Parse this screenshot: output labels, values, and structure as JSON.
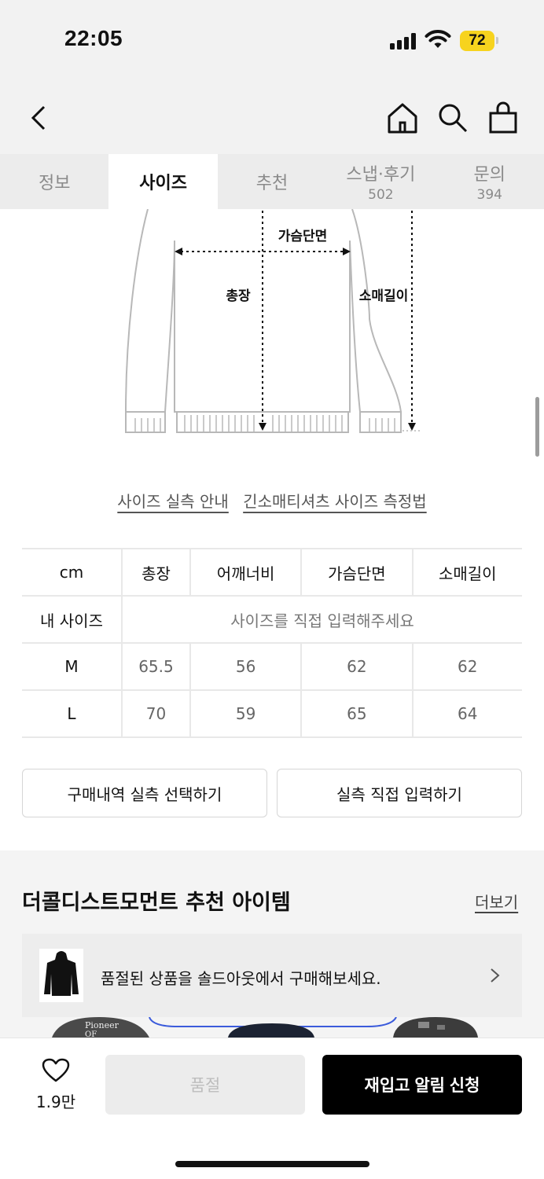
{
  "status_bar": {
    "time": "22:05",
    "battery": "72"
  },
  "header": {
    "back_icon": "chevron-left-icon",
    "icons": [
      "home-icon",
      "search-icon",
      "shopping-bag-icon"
    ]
  },
  "tabs": [
    {
      "label": "정보",
      "count": ""
    },
    {
      "label": "사이즈",
      "count": "",
      "active": true
    },
    {
      "label": "추천",
      "count": ""
    },
    {
      "label": "스냅·후기",
      "count": "502"
    },
    {
      "label": "문의",
      "count": "394"
    }
  ],
  "diagram": {
    "label_chest": "가슴단면",
    "label_length": "총장",
    "label_sleeve": "소매길이"
  },
  "size_links": {
    "guide": "사이즈 실측 안내",
    "measure_method": "긴소매티셔츠 사이즈 측정법"
  },
  "size_table": {
    "unit": "cm",
    "columns": [
      "총장",
      "어깨너비",
      "가슴단면",
      "소매길이"
    ],
    "my_size_label": "내 사이즈",
    "my_size_prompt": "사이즈를 직접 입력해주세요",
    "rows": [
      {
        "size": "M",
        "values": [
          "65.5",
          "56",
          "62",
          "62"
        ]
      },
      {
        "size": "L",
        "values": [
          "70",
          "59",
          "65",
          "64"
        ]
      }
    ]
  },
  "actions": {
    "select_purchase": "구매내역 실측 선택하기",
    "manual_input": "실측 직접 입력하기"
  },
  "recommend": {
    "title": "더콜디스트모먼트 추천 아이템",
    "more": "더보기",
    "soldout_banner": "품절된 상품을 솔드아웃에서 구매해보세요."
  },
  "bottom_bar": {
    "like_count": "1.9만",
    "soldout_label": "품절",
    "restock_label": "재입고 알림 신청"
  },
  "colors": {
    "accent_battery": "#f7d31e",
    "primary_button": "#000000"
  }
}
